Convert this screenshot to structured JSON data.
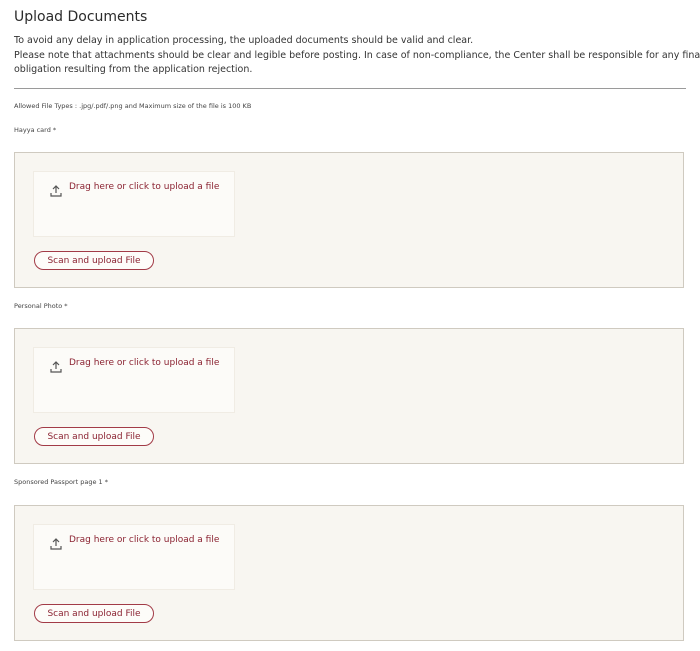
{
  "page": {
    "title": "Upload Documents",
    "intro_lines": [
      "To avoid any delay in application processing, the uploaded documents should be valid and clear.",
      "Please note that attachments should be clear and legible before posting. In case of non-compliance, the Center shall be responsible for any financial",
      "obligation resulting from the application rejection."
    ],
    "allowed_types": "Allowed File Types : .jpg/.pdf/.png and Maximum size of the file is 100 KB"
  },
  "uploads": [
    {
      "label": "Hayya card *",
      "dropzone_text": "Drag here or click to upload a file",
      "scan_button": "Scan and upload File",
      "icon": "upload-icon"
    },
    {
      "label": "Personal Photo *",
      "dropzone_text": "Drag here or click to upload a file",
      "scan_button": "Scan and upload File",
      "icon": "upload-icon"
    },
    {
      "label": "Sponsored Passport page 1 *",
      "dropzone_text": "Drag here or click to upload a file",
      "scan_button": "Scan and upload File",
      "icon": "upload-icon"
    }
  ],
  "colors": {
    "accent": "#8b2332",
    "panel_background": "#f8f6f1",
    "panel_border": "#cfcac0"
  }
}
